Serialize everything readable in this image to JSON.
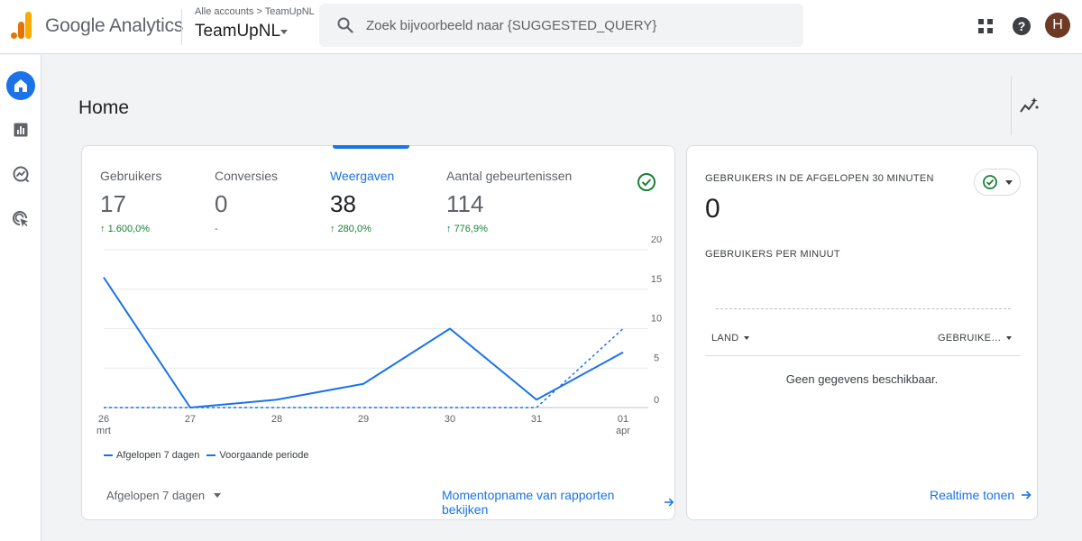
{
  "header": {
    "app_name": "Google Analytics",
    "breadcrumb": "Alle accounts > TeamUpNL",
    "property_name": "TeamUpNL",
    "search_placeholder": "Zoek bijvoorbeeld naar {SUGGESTED_QUERY}",
    "avatar_initial": "H",
    "icons": [
      "apps-grid-icon",
      "help-icon"
    ]
  },
  "sidebar": {
    "items": [
      {
        "name": "home",
        "icon": "home-icon",
        "active": true
      },
      {
        "name": "reports",
        "icon": "bar-chart-icon",
        "active": false
      },
      {
        "name": "explore",
        "icon": "explore-icon",
        "active": false
      },
      {
        "name": "advertising",
        "icon": "cursor-target-icon",
        "active": false
      }
    ]
  },
  "page": {
    "title": "Home",
    "insights_icon": "insights-icon"
  },
  "overview_card": {
    "metrics": [
      {
        "label": "Gebruikers",
        "value": "17",
        "change": "1.600,0%",
        "trend": "up"
      },
      {
        "label": "Conversies",
        "value": "0",
        "change": "-",
        "trend": "none"
      },
      {
        "label": "Weergaven",
        "value": "38",
        "change": "280,0%",
        "trend": "up",
        "active": true
      },
      {
        "label": "Aantal gebeurtenissen",
        "value": "114",
        "change": "776,9%",
        "trend": "up"
      }
    ],
    "legend": {
      "current": "Afgelopen 7 dagen",
      "previous": "Voorgaande periode"
    },
    "date_range": "Afgelopen 7 dagen",
    "link": "Momentopname van rapporten bekijken"
  },
  "chart_data": {
    "type": "line",
    "x": [
      "26 mrt",
      "27",
      "28",
      "29",
      "30",
      "31",
      "01 apr"
    ],
    "x_ticks": [
      {
        "top": "26",
        "bottom": "mrt"
      },
      {
        "top": "27",
        "bottom": ""
      },
      {
        "top": "28",
        "bottom": ""
      },
      {
        "top": "29",
        "bottom": ""
      },
      {
        "top": "30",
        "bottom": ""
      },
      {
        "top": "31",
        "bottom": ""
      },
      {
        "top": "01",
        "bottom": "apr"
      }
    ],
    "y_ticks": [
      0,
      5,
      10,
      15,
      20
    ],
    "ylim": [
      0,
      20
    ],
    "series": [
      {
        "name": "Afgelopen 7 dagen",
        "style": "solid",
        "values": [
          16.5,
          0,
          1,
          3,
          10,
          1,
          7
        ]
      },
      {
        "name": "Voorgaande periode",
        "style": "dashed",
        "values": [
          0,
          0,
          0,
          0,
          0,
          0,
          10
        ]
      }
    ],
    "grid": true,
    "y_axis_side": "right",
    "legend_position": "bottom-left",
    "color": "#1a73e8"
  },
  "realtime_card": {
    "title": "GEBRUIKERS IN DE AFGELOPEN 30 MINUTEN",
    "value": "0",
    "subtitle": "GEBRUIKERS PER MINUUT",
    "columns": [
      "LAND",
      "GEBRUIKE…"
    ],
    "empty_message": "Geen gegevens beschikbaar.",
    "link": "Realtime tonen"
  },
  "colors": {
    "accent": "#1a73e8",
    "positive": "#188038",
    "check": "#188038",
    "avatar": "#6d3a26"
  }
}
